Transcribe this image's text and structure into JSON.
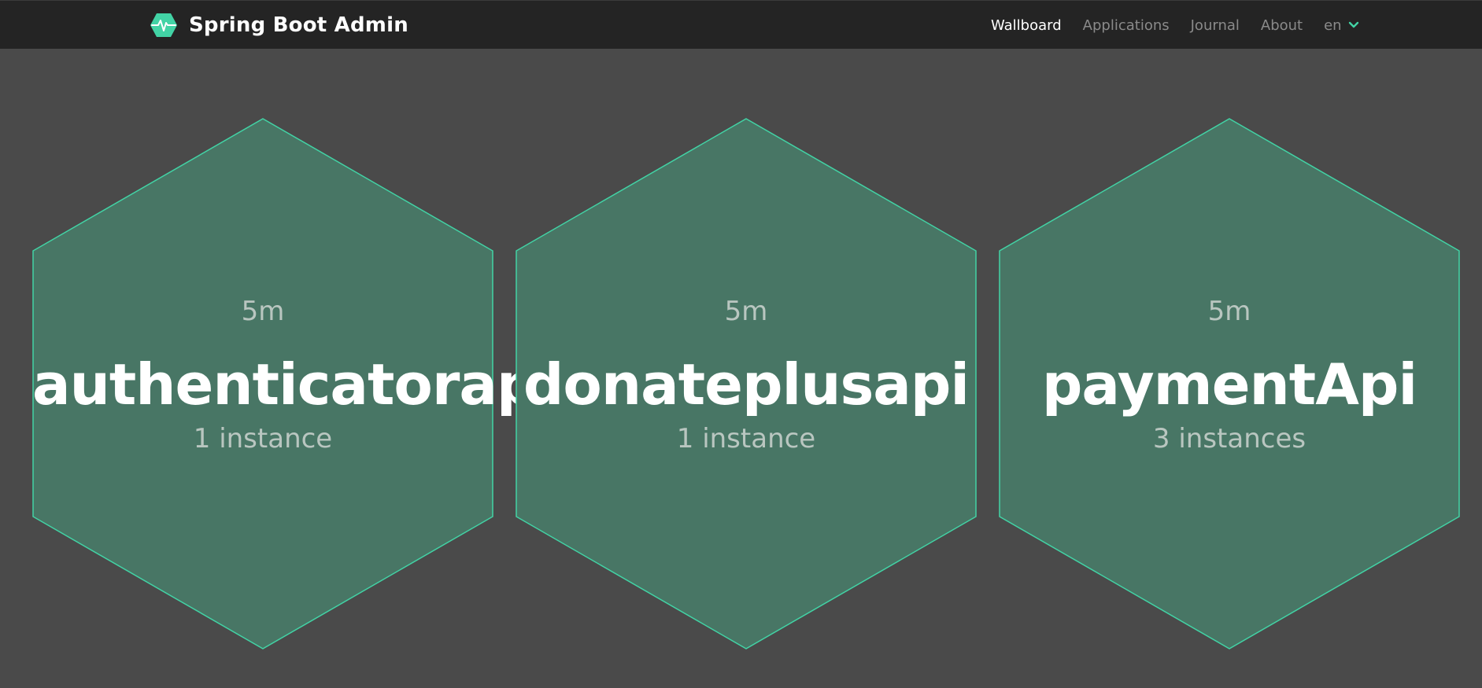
{
  "app": {
    "title": "Spring Boot Admin",
    "logo_icon": "heartbeat-hexagon-icon",
    "accent_color": "#42d3a5"
  },
  "nav": {
    "items": [
      {
        "label": "Wallboard",
        "active": true
      },
      {
        "label": "Applications",
        "active": false
      },
      {
        "label": "Journal",
        "active": false
      },
      {
        "label": "About",
        "active": false
      }
    ],
    "language": {
      "label": "en",
      "icon": "chevron-down-icon"
    }
  },
  "applications": [
    {
      "name": "authenticatorapi",
      "uptime": "5m",
      "instances": "1 instance",
      "status_color": "#487665"
    },
    {
      "name": "donateplusapi",
      "uptime": "5m",
      "instances": "1 instance",
      "status_color": "#487665"
    },
    {
      "name": "paymentApi",
      "uptime": "5m",
      "instances": "3 instances",
      "status_color": "#487665"
    }
  ]
}
